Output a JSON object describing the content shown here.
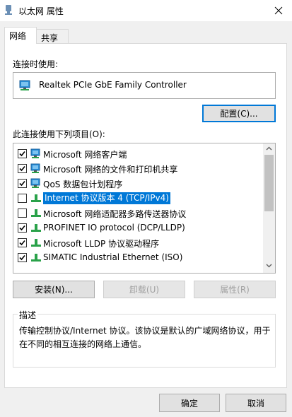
{
  "window": {
    "title": "以太网 属性"
  },
  "tabs": [
    {
      "label": "网络"
    },
    {
      "label": "共享"
    }
  ],
  "connect_using": {
    "label": "连接时使用:",
    "adapter": "Realtek PCIe GbE Family Controller",
    "configure_button": "配置(C)..."
  },
  "items_section": {
    "label": "此连接使用下列项目(O):",
    "items": [
      {
        "label": "Microsoft 网络客户端",
        "checked": true,
        "icon": "network-client-icon"
      },
      {
        "label": "Microsoft 网络的文件和打印机共享",
        "checked": true,
        "icon": "network-client-icon"
      },
      {
        "label": "QoS 数据包计划程序",
        "checked": true,
        "icon": "network-client-icon"
      },
      {
        "label": "Internet 协议版本 4 (TCP/IPv4)",
        "checked": false,
        "selected": true,
        "icon": "protocol-icon"
      },
      {
        "label": "Microsoft 网络适配器多路传送器协议",
        "checked": false,
        "icon": "protocol-icon"
      },
      {
        "label": "PROFINET IO protocol (DCP/LLDP)",
        "checked": true,
        "icon": "protocol-icon"
      },
      {
        "label": "Microsoft LLDP 协议驱动程序",
        "checked": true,
        "icon": "protocol-icon"
      },
      {
        "label": "SIMATIC Industrial Ethernet (ISO)",
        "checked": true,
        "icon": "protocol-icon"
      }
    ]
  },
  "buttons": {
    "install": "安装(N)...",
    "uninstall": "卸载(U)",
    "properties": "属性(R)"
  },
  "description": {
    "title": "描述",
    "text": "传输控制协议/Internet 协议。该协议是默认的广域网络协议，用于在不同的相互连接的网络上通信。"
  },
  "dialog_buttons": {
    "ok": "确定",
    "cancel": "取消"
  },
  "colors": {
    "selection": "#0078d7",
    "focus_border": "#0078d7"
  }
}
